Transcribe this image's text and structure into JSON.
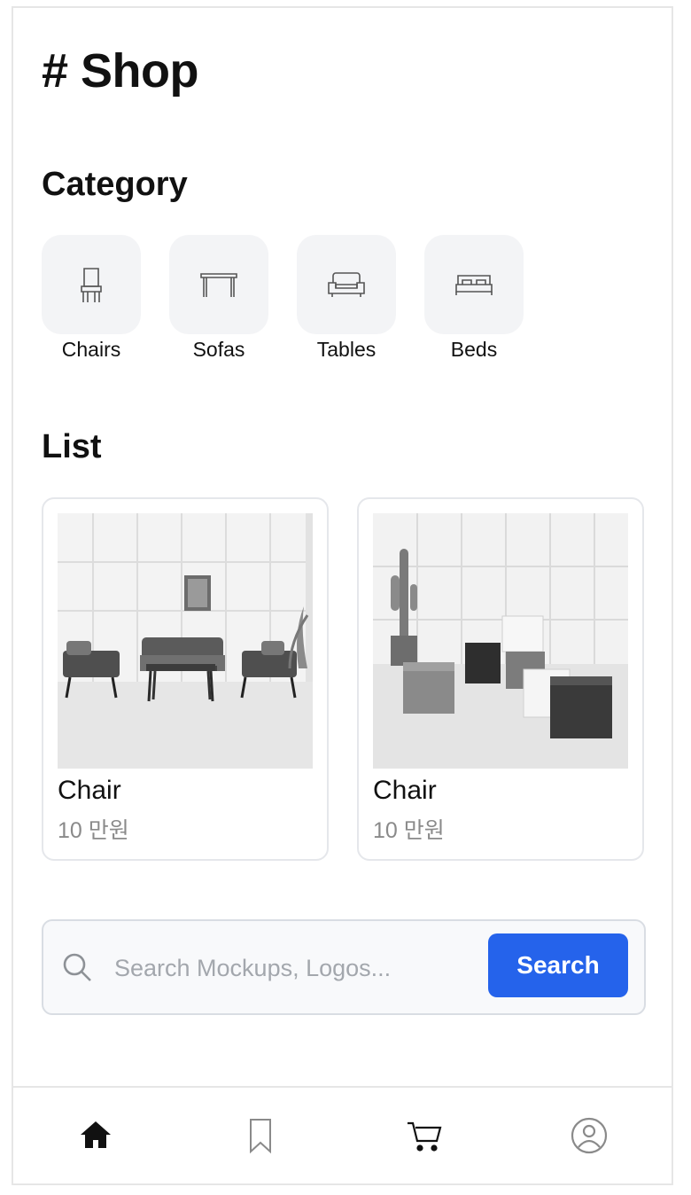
{
  "header": {
    "title": "# Shop"
  },
  "category": {
    "title": "Category",
    "items": [
      {
        "label": "Chairs",
        "icon": "chair-icon"
      },
      {
        "label": "Sofas",
        "icon": "table-icon"
      },
      {
        "label": "Tables",
        "icon": "sofa-icon"
      },
      {
        "label": "Beds",
        "icon": "bed-icon"
      }
    ]
  },
  "list": {
    "title": "List",
    "items": [
      {
        "name": "Chair",
        "price": "10 만원",
        "image": "living-room-photo"
      },
      {
        "name": "Chair",
        "price": "10 만원",
        "image": "cube-stools-photo"
      }
    ]
  },
  "search": {
    "placeholder": "Search Mockups, Logos...",
    "button_label": "Search",
    "button_color": "#2563eb"
  },
  "bottom_nav": [
    {
      "icon": "home-icon",
      "active": true
    },
    {
      "icon": "bookmark-icon",
      "active": false
    },
    {
      "icon": "cart-icon",
      "active": false
    },
    {
      "icon": "profile-icon",
      "active": false
    }
  ]
}
